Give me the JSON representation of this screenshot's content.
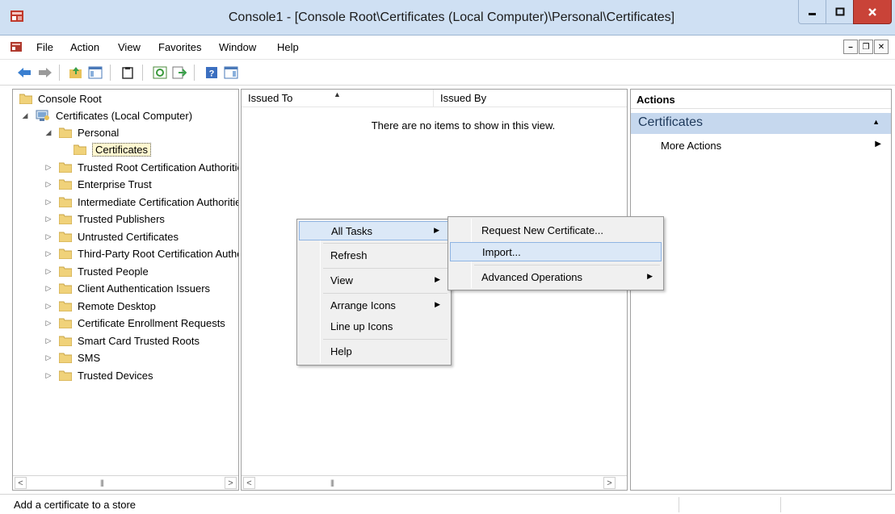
{
  "window": {
    "title": "Console1 - [Console Root\\Certificates (Local Computer)\\Personal\\Certificates]"
  },
  "menu": {
    "items": [
      "File",
      "Action",
      "View",
      "Favorites",
      "Window",
      "Help"
    ]
  },
  "tree": {
    "nodes": [
      {
        "label": "Console Root"
      },
      {
        "label": "Certificates (Local Computer)"
      },
      {
        "label": "Personal"
      },
      {
        "label": "Certificates",
        "selected": true
      },
      {
        "label": "Trusted Root Certification Authorities"
      },
      {
        "label": "Enterprise Trust"
      },
      {
        "label": "Intermediate Certification Authorities"
      },
      {
        "label": "Trusted Publishers"
      },
      {
        "label": "Untrusted Certificates"
      },
      {
        "label": "Third-Party Root Certification Authorities"
      },
      {
        "label": "Trusted People"
      },
      {
        "label": "Client Authentication Issuers"
      },
      {
        "label": "Remote Desktop"
      },
      {
        "label": "Certificate Enrollment Requests"
      },
      {
        "label": "Smart Card Trusted Roots"
      },
      {
        "label": "SMS"
      },
      {
        "label": "Trusted Devices"
      }
    ]
  },
  "list": {
    "columns": [
      "Issued To",
      "Issued By"
    ],
    "empty_message": "There are no items to show in this view."
  },
  "actions": {
    "title": "Actions",
    "section": "Certificates",
    "items": [
      "More Actions"
    ]
  },
  "context_menu": {
    "items": [
      "All Tasks",
      "Refresh",
      "View",
      "Arrange Icons",
      "Line up Icons",
      "Help"
    ],
    "highlighted": "All Tasks"
  },
  "submenu": {
    "items": [
      "Request New Certificate...",
      "Import...",
      "Advanced Operations"
    ],
    "highlighted": "Import..."
  },
  "status": {
    "text": "Add a certificate to a store"
  },
  "colors": {
    "titlebar": "#cfe0f3",
    "close_button": "#c94338",
    "highlight": "#dbe8f7",
    "actions_section": "#c6d8ee"
  }
}
